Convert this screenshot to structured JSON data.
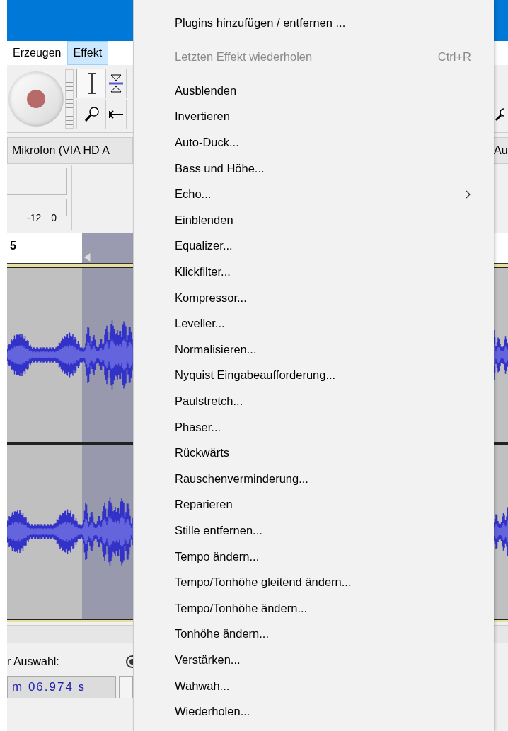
{
  "menubar": [
    {
      "label": "Erzeugen",
      "selected": false
    },
    {
      "label": "Effekt",
      "selected": true
    }
  ],
  "device": {
    "value": "Mikrofon (VIA HD A"
  },
  "right_device": {
    "value": "Au"
  },
  "meter": {
    "ticks": [
      "-12",
      "0"
    ]
  },
  "ruler": {
    "label": "5"
  },
  "selection_toolbar": {
    "label": "r Auswahl:",
    "time": "m 06.974 s",
    "radio_selected": true
  },
  "menu": {
    "items": [
      {
        "kind": "item",
        "label": "Plugins hinzufügen / entfernen ...",
        "disabled": false
      },
      {
        "kind": "separator"
      },
      {
        "kind": "item",
        "label": "Letzten Effekt wiederholen",
        "shortcut": "Ctrl+R",
        "disabled": true
      },
      {
        "kind": "separator"
      },
      {
        "kind": "item",
        "label": "Ausblenden",
        "disabled": false
      },
      {
        "kind": "item",
        "label": "Invertieren",
        "disabled": false
      },
      {
        "kind": "item",
        "label": "Auto-Duck...",
        "disabled": false
      },
      {
        "kind": "item",
        "label": "Bass und Höhe...",
        "disabled": false
      },
      {
        "kind": "submenu",
        "label": "Echo...",
        "disabled": false
      },
      {
        "kind": "item",
        "label": "Einblenden",
        "disabled": false
      },
      {
        "kind": "item",
        "label": "Equalizer...",
        "disabled": false
      },
      {
        "kind": "item",
        "label": "Klickfilter...",
        "disabled": false
      },
      {
        "kind": "item",
        "label": "Kompressor...",
        "disabled": false
      },
      {
        "kind": "item",
        "label": "Leveller...",
        "disabled": false
      },
      {
        "kind": "item",
        "label": "Normalisieren...",
        "disabled": false
      },
      {
        "kind": "item",
        "label": "Nyquist Eingabeaufforderung...",
        "disabled": false
      },
      {
        "kind": "item",
        "label": "Paulstretch...",
        "disabled": false
      },
      {
        "kind": "item",
        "label": "Phaser...",
        "disabled": false
      },
      {
        "kind": "item",
        "label": "Rückwärts",
        "disabled": false
      },
      {
        "kind": "item",
        "label": "Rauschenverminderung...",
        "disabled": false
      },
      {
        "kind": "item",
        "label": "Reparieren",
        "disabled": false
      },
      {
        "kind": "item",
        "label": "Stille entfernen...",
        "disabled": false
      },
      {
        "kind": "item",
        "label": "Tempo ändern...",
        "disabled": false
      },
      {
        "kind": "item",
        "label": "Tempo/Tonhöhe gleitend ändern...",
        "disabled": false
      },
      {
        "kind": "item",
        "label": "Tempo/Tonhöhe ändern...",
        "disabled": false
      },
      {
        "kind": "item",
        "label": "Tonhöhe ändern...",
        "disabled": false
      },
      {
        "kind": "item",
        "label": "Verstärken...",
        "disabled": false
      },
      {
        "kind": "item",
        "label": "Wahwah...",
        "disabled": false
      },
      {
        "kind": "item",
        "label": "Wiederholen...",
        "disabled": false
      }
    ]
  }
}
